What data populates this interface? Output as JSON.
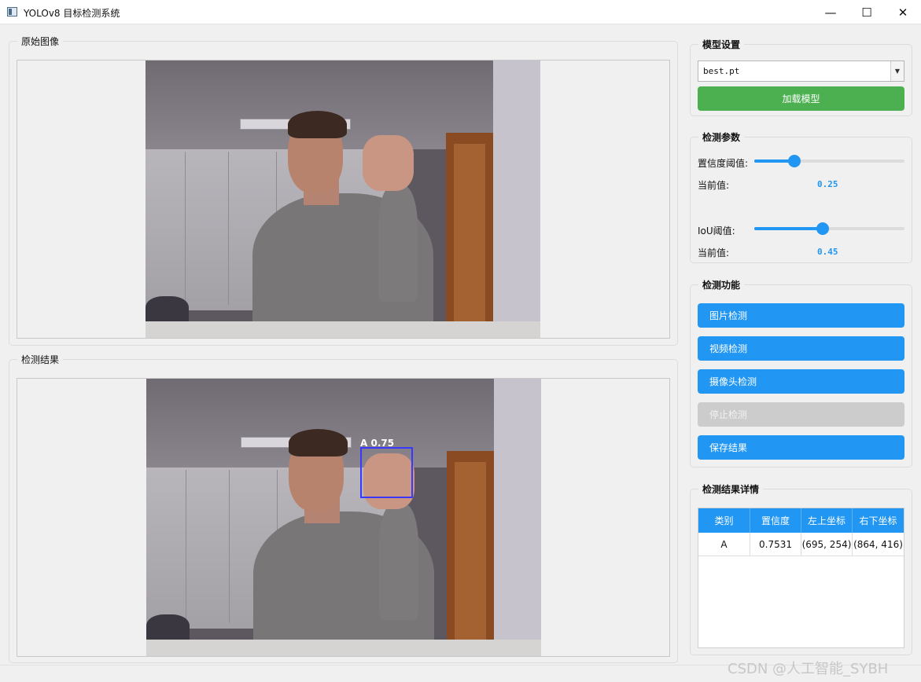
{
  "window": {
    "title": "YOLOv8 目标检测系统",
    "minimize_glyph": "—",
    "maximize_glyph": "☐",
    "close_glyph": "✕"
  },
  "original_panel": {
    "title": "原始图像"
  },
  "result_panel": {
    "title": "检测结果",
    "detection_label": "A 0.75"
  },
  "model_settings": {
    "title": "模型设置",
    "model_select_value": "best.pt",
    "load_button": "加载模型"
  },
  "detection_params": {
    "title": "检测参数",
    "confidence_label": "置信度阈值:",
    "confidence_current_label": "当前值:",
    "confidence_value": "0.25",
    "confidence_level": 0.25,
    "iou_label": "IoU阈值:",
    "iou_current_label": "当前值:",
    "iou_value": "0.45",
    "iou_level": 0.45
  },
  "detection_functions": {
    "title": "检测功能",
    "image_button": "图片检测",
    "video_button": "视频检测",
    "camera_button": "摄像头检测",
    "stop_button": "停止检测",
    "save_button": "保存结果"
  },
  "results_table": {
    "title": "检测结果详情",
    "headers": [
      "类别",
      "置信度",
      "左上坐标",
      "右下坐标"
    ],
    "rows": [
      [
        "A",
        "0.7531",
        "(695, 254)",
        "(864, 416)"
      ]
    ]
  },
  "watermark": "CSDN @人工智能_SYBH",
  "colors": {
    "accent_blue": "#2196f3",
    "load_green": "#4caf50",
    "disabled_gray": "#cccccc",
    "bbox_blue": "#3a37ff"
  },
  "icons": [
    "app-window-icon",
    "minimize-icon",
    "maximize-icon",
    "close-icon",
    "dropdown-arrow-icon"
  ]
}
